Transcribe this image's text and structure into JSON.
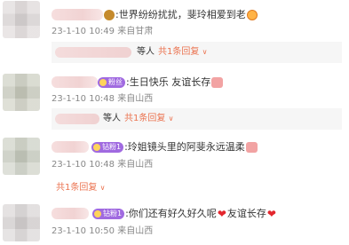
{
  "comments": [
    {
      "text": ":世界纷纷扰扰，斐玲相爱到老",
      "time": "23-1-10 10:49",
      "location": "来自甘肃",
      "reply_name": "等人",
      "reply_link": "共1条回复",
      "reply_chevron": "∨"
    },
    {
      "badge": "粉丝",
      "text": ":生日快乐 友谊长存",
      "time": "23-1-10 10:48",
      "location": "来自山西",
      "reply_name": "等人",
      "reply_link": "共1条回复",
      "reply_chevron": "∨"
    },
    {
      "badge": "钻粉1",
      "text": ":玲姐镜头里的阿斐永远温柔",
      "time": "23-1-10 10:48",
      "location": "来自山西",
      "reply_link": "共1条回复",
      "reply_chevron": "∨"
    },
    {
      "badge": "钻粉1",
      "text": ":你们还有好久好久呢",
      "heart": "❤",
      "text_after": "友谊长存",
      "time": "23-1-10 10:50",
      "location": "来自山西"
    }
  ],
  "colors": {
    "link": "#eb7350",
    "badge": "#a06ae0",
    "heart": "#e3262d"
  }
}
